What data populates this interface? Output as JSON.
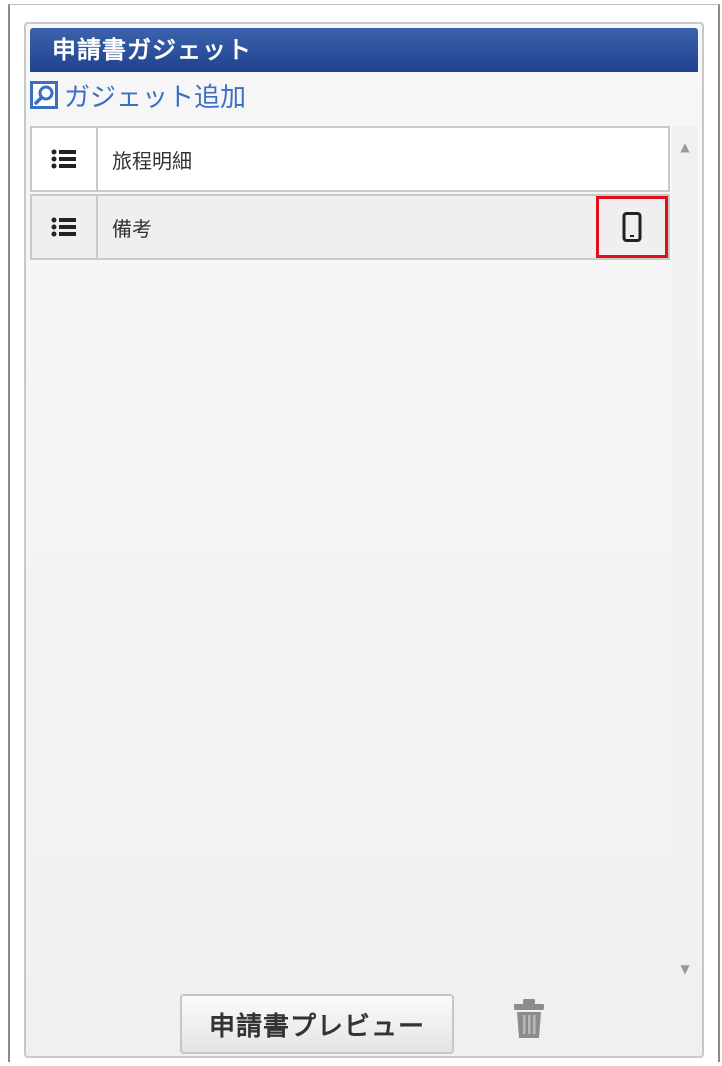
{
  "panel": {
    "title": "申請書ガジェット",
    "add_link_label": "ガジェット追加",
    "preview_button_label": "申請書プレビュー"
  },
  "gadgets": [
    {
      "name": "旅程明細",
      "mobile": false
    },
    {
      "name": "備考",
      "mobile": true
    }
  ],
  "icons": {
    "add": "search-icon",
    "handle": "list-icon",
    "mobile": "smartphone-icon",
    "delete": "trash-icon"
  },
  "colors": {
    "header_bg": "#1f418e",
    "link": "#3a6fc4",
    "highlight": "#e0101c"
  }
}
